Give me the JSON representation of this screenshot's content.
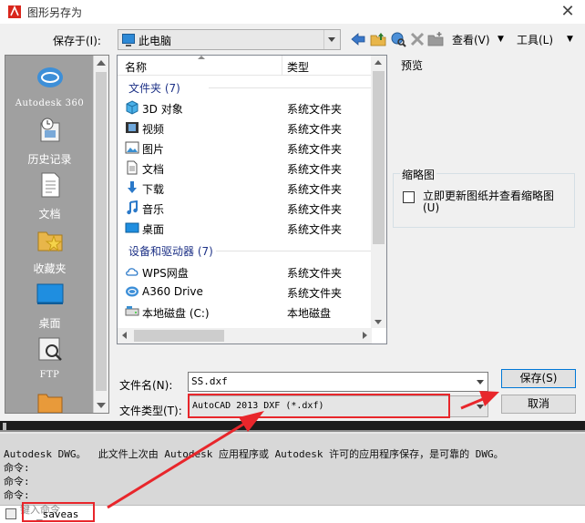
{
  "window": {
    "title": "图形另存为",
    "close_glyph": "✕"
  },
  "savein": {
    "label": "保存于(I):",
    "value": "此电脑"
  },
  "toolbar": {
    "view_label": "查看(V)",
    "tools_label": "工具(L)"
  },
  "places": [
    {
      "label": "Autodesk 360",
      "icon": "autodesk360-icon"
    },
    {
      "label": "历史记录",
      "icon": "history-icon"
    },
    {
      "label": "文档",
      "icon": "documents-icon"
    },
    {
      "label": "收藏夹",
      "icon": "favorites-icon"
    },
    {
      "label": "桌面",
      "icon": "desktop-icon"
    },
    {
      "label": "FTP",
      "icon": "ftp-icon"
    }
  ],
  "filelist": {
    "col_name": "名称",
    "col_type": "类型",
    "group1": "文件夹 (7)",
    "group2": "设备和驱动器 (7)",
    "rows": [
      {
        "name": "3D 对象",
        "type": "系统文件夹",
        "icon": "3d-objects-icon"
      },
      {
        "name": "视频",
        "type": "系统文件夹",
        "icon": "video-icon"
      },
      {
        "name": "图片",
        "type": "系统文件夹",
        "icon": "pictures-icon"
      },
      {
        "name": "文档",
        "type": "系统文件夹",
        "icon": "documents-icon"
      },
      {
        "name": "下载",
        "type": "系统文件夹",
        "icon": "download-icon"
      },
      {
        "name": "音乐",
        "type": "系统文件夹",
        "icon": "music-icon"
      },
      {
        "name": "桌面",
        "type": "系统文件夹",
        "icon": "desktop-icon"
      },
      {
        "name": "WPS网盘",
        "type": "系统文件夹",
        "icon": "cloud-icon"
      },
      {
        "name": "A360 Drive",
        "type": "系统文件夹",
        "icon": "a360-icon"
      },
      {
        "name": "本地磁盘 (C:)",
        "type": "本地磁盘",
        "icon": "drive-icon"
      }
    ]
  },
  "preview": {
    "label": "预览"
  },
  "thumbnail": {
    "legend": "缩略图",
    "checkbox_label": "立即更新图纸并查看缩略图(U)"
  },
  "filename": {
    "label": "文件名(N):",
    "value": "SS.dxf"
  },
  "filetype": {
    "label": "文件类型(T):",
    "value": "AutoCAD 2013 DXF (*.dxf)"
  },
  "buttons": {
    "save": "保存(S)",
    "cancel": "取消"
  },
  "command": {
    "history": [
      "Autodesk DWG。  此文件上次由 Autodesk 应用程序或 Autodesk 许可的应用程序保存，是可靠的 DWG。",
      "命令:",
      "命令:",
      "命令:"
    ],
    "input": "_saveas",
    "hint": "键入命令"
  },
  "colors": {
    "annotation_red": "#e8262b",
    "accent_blue": "#0078d7"
  }
}
